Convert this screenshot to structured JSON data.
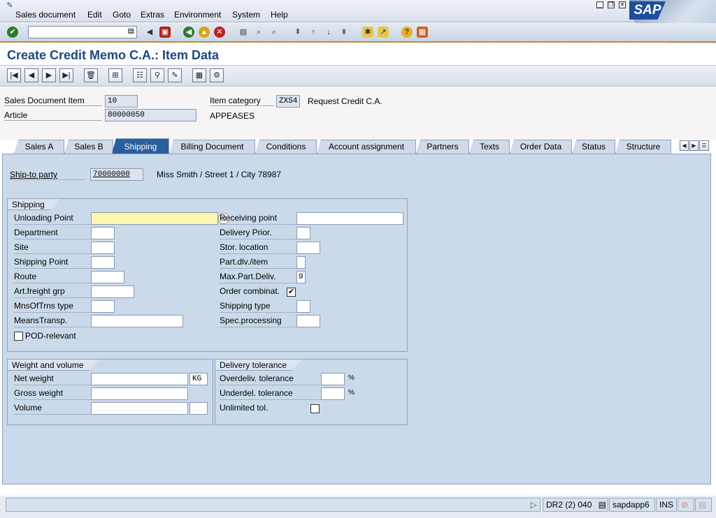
{
  "menu": [
    "Sales document",
    "Edit",
    "Goto",
    "Extras",
    "Environment",
    "System",
    "Help"
  ],
  "logo": "SAP",
  "title": "Create Credit Memo C.A.: Item Data",
  "header": {
    "sales_doc_item_label": "Sales Document Item",
    "sales_doc_item_value": "10",
    "article_label": "Article",
    "article_value": "80000050",
    "article_desc": "APPEASES",
    "item_category_label": "Item category",
    "item_category_value": "ZXS4",
    "item_category_desc": "Request Credit C.A."
  },
  "tabs": [
    "Sales A",
    "Sales B",
    "Shipping",
    "Billing Document",
    "Conditions",
    "Account assignment",
    "Partners",
    "Texts",
    "Order Data",
    "Status",
    "Structure"
  ],
  "active_tab": "Shipping",
  "shipto": {
    "label": "Ship-to party",
    "value": "70000000",
    "desc": "Miss Smith / Street 1 / City 78987"
  },
  "shipping": {
    "title": "Shipping",
    "left": [
      {
        "label": "Unloading Point",
        "value": ""
      },
      {
        "label": "Department",
        "value": ""
      },
      {
        "label": "Site",
        "value": ""
      },
      {
        "label": "Shipping Point",
        "value": ""
      },
      {
        "label": "Route",
        "value": ""
      },
      {
        "label": "Art.freight grp",
        "value": ""
      },
      {
        "label": "MnsOfTrns type",
        "value": ""
      },
      {
        "label": "MeansTransp.",
        "value": ""
      }
    ],
    "pod_label": "POD-relevant",
    "right": [
      {
        "label": "Receiving point",
        "value": ""
      },
      {
        "label": "Delivery Prior.",
        "value": ""
      },
      {
        "label": "Stor. location",
        "value": ""
      },
      {
        "label": "Part.dlv./item",
        "value": ""
      },
      {
        "label": "Max.Part.Deliv.",
        "value": "9"
      },
      {
        "label": "Order combinat.",
        "value": "✔"
      },
      {
        "label": "Shipping type",
        "value": ""
      },
      {
        "label": "Spec.processing",
        "value": ""
      }
    ]
  },
  "weight": {
    "title": "Weight and volume",
    "net_label": "Net weight",
    "net_unit": "KG",
    "gross_label": "Gross weight",
    "volume_label": "Volume"
  },
  "tolerance": {
    "title": "Delivery tolerance",
    "over_label": "Overdeliv. tolerance",
    "under_label": "Underdel. tolerance",
    "unlimited_label": "Unlimited tol.",
    "percent": "%"
  },
  "status": {
    "system": "DR2 (2) 040",
    "server": "sapdapp6",
    "mode": "INS"
  }
}
